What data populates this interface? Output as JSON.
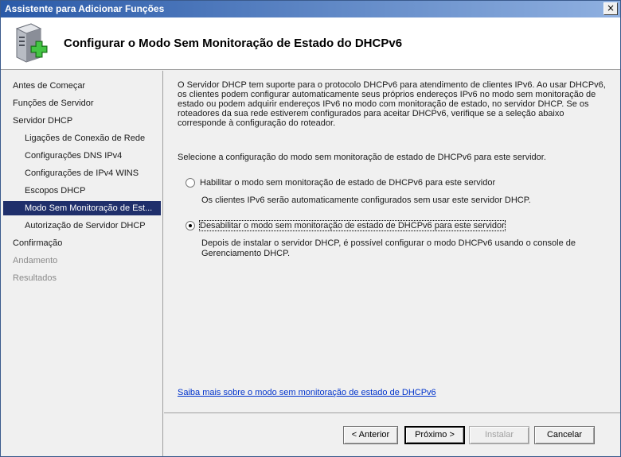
{
  "window": {
    "title": "Assistente para Adicionar Funções",
    "close_glyph": "×"
  },
  "header": {
    "title": "Configurar o Modo Sem Monitoração de Estado do DHCPv6",
    "icon": "server-add-role-icon"
  },
  "nav": {
    "items": [
      {
        "label": "Antes de Começar",
        "state": "normal"
      },
      {
        "label": "Funções de Servidor",
        "state": "normal"
      },
      {
        "label": "Servidor DHCP",
        "state": "normal"
      },
      {
        "label": "Ligações de Conexão de Rede",
        "state": "normal"
      },
      {
        "label": "Configurações DNS IPv4",
        "state": "normal"
      },
      {
        "label": "Configurações de IPv4 WINS",
        "state": "normal"
      },
      {
        "label": "Escopos DHCP",
        "state": "normal"
      },
      {
        "label": "Modo Sem Monitoração de Est...",
        "state": "selected"
      },
      {
        "label": "Autorização de Servidor DHCP",
        "state": "normal"
      },
      {
        "label": "Confirmação",
        "state": "normal"
      },
      {
        "label": "Andamento",
        "state": "disabled"
      },
      {
        "label": "Resultados",
        "state": "disabled"
      }
    ]
  },
  "content": {
    "intro_lines": [
      "O Servidor DHCP tem suporte para o protocolo DHCPv6 para atendimento de clientes IPv6. Ao usar DHCPv6,",
      "os clientes podem configurar automaticamente seus próprios endereços IPv6 no modo sem monitoração de",
      "estado ou podem adquirir endereços IPv6 no modo com monitoração de estado, no servidor DHCP. Se os",
      "roteadores da sua rede estiverem configurados para aceitar DHCPv6, verifique se a seleção abaixo",
      "corresponde à configuração do roteador."
    ],
    "prompt": "Selecione a configuração do modo sem monitoração de estado de DHCPv6 para este servidor.",
    "option_enable": {
      "label": "Habilitar o modo sem monitoração de estado de DHCPv6 para este servidor",
      "description": "Os clientes IPv6 serão automaticamente configurados sem usar este servidor DHCP.",
      "checked": false
    },
    "option_disable": {
      "label": "Desabilitar o modo sem monitoração de estado de DHCPv6 para este servidor",
      "description_lines": [
        "Depois de instalar o servidor DHCP, é possível configurar o modo DHCPv6 usando o console de",
        "Gerenciamento DHCP."
      ],
      "checked": true
    },
    "link": "Saiba mais sobre o modo sem monitoração de estado de DHCPv6"
  },
  "buttons": {
    "back": "< Anterior",
    "next": "Próximo >",
    "install": "Instalar",
    "cancel": "Cancelar"
  }
}
